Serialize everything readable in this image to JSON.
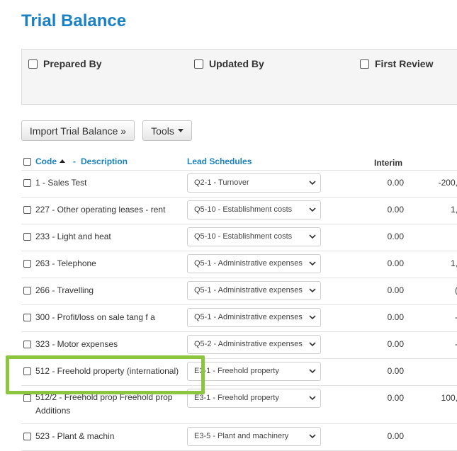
{
  "page_title": "Trial Balance",
  "signoff": {
    "prepared_by": "Prepared By",
    "updated_by": "Updated By",
    "first_review": "First Review"
  },
  "toolbar": {
    "import_label": "Import Trial Balance »",
    "tools_label": "Tools"
  },
  "table": {
    "headers": {
      "code": "Code",
      "separator": "-",
      "description": "Description",
      "lead_schedules": "Lead Schedules",
      "interim": "Interim"
    },
    "rows": [
      {
        "label": "1 - Sales Test",
        "schedule": "Q2-1 - Turnover",
        "interim": "0.00",
        "final": "-200,"
      },
      {
        "label": "227 - Other operating leases - rent",
        "schedule": "Q5-10 - Establishment costs",
        "interim": "0.00",
        "final": "1,"
      },
      {
        "label": "233 - Light and heat",
        "schedule": "Q5-10 - Establishment costs",
        "interim": "0.00",
        "final": ""
      },
      {
        "label": "263 - Telephone",
        "schedule": "Q5-1 - Administrative expenses",
        "interim": "0.00",
        "final": "1,"
      },
      {
        "label": "266 - Travelling",
        "schedule": "Q5-1 - Administrative expenses",
        "interim": "0.00",
        "final": "("
      },
      {
        "label": "300 - Profit/loss on sale tang f a",
        "schedule": "Q5-1 - Administrative expenses",
        "interim": "0.00",
        "final": "-"
      },
      {
        "label": "323 - Motor expenses",
        "schedule": "Q5-2 - Administrative expenses",
        "interim": "0.00",
        "final": "-"
      },
      {
        "label": "512 - Freehold property (international)",
        "schedule": "E3-1 - Freehold property",
        "interim": "0.00",
        "final": ""
      },
      {
        "label": "512/2 - Freehold prop Freehold prop Additions",
        "schedule": "E3-1 - Freehold property",
        "interim": "0.00",
        "final": "100,"
      },
      {
        "label": "523 - Plant & machin",
        "schedule": "E3-5 - Plant and machinery",
        "interim": "0.00",
        "final": ""
      }
    ]
  },
  "colors": {
    "accent": "#1a82c4",
    "highlight": "#8cc63f"
  }
}
